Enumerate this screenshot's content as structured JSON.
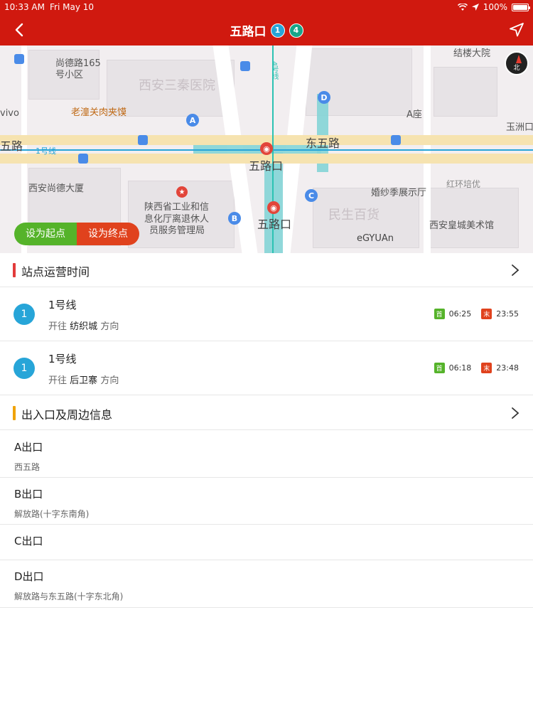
{
  "status": {
    "time": "10:33 AM",
    "date": "Fri May 10",
    "battery": "100%"
  },
  "nav": {
    "title": "五路口",
    "lines": [
      {
        "label": "1",
        "color": "#27a5d8"
      },
      {
        "label": "4",
        "color": "#17a589"
      }
    ]
  },
  "map": {
    "labels": {
      "shangde165": "尚德路165",
      "xiaoqu": "号小区",
      "hospital": "西安三秦医院",
      "jielou": "结楼大院",
      "vivo": "vivo",
      "laotong": "老潼关肉夹馍",
      "line4": "4号线",
      "azuo": "A座",
      "yuzhou": "玉洲口",
      "wulu_left": "五路",
      "line1": "1号线",
      "dongwulu": "东五路",
      "wukou_center": "五路口",
      "xian_shangde": "西安尚德大厦",
      "shaanxi": "陕西省工业和信",
      "shaanxi2": "息化厅离退休人",
      "shaanxi3": "员服务管理局",
      "hunsha": "婚纱季展示厅",
      "honghuan": "红环培优",
      "minsheng": "民生百货",
      "wukou_lower": "五路口",
      "xian_huangcheng": "西安皇城美术馆",
      "egyuan": "eGYUAn"
    },
    "exits": [
      "A",
      "B",
      "C",
      "D"
    ],
    "buttons": {
      "set_start": "设为起点",
      "set_end": "设为终点"
    },
    "compass": "北"
  },
  "hours_section": {
    "title": "站点运营时间",
    "bar_color": "#e23b3b"
  },
  "lines": [
    {
      "badge": "1",
      "name": "1号线",
      "dir_prefix": "开往",
      "destination": "纺织城",
      "dir_suffix": "方向",
      "first_tag": "首",
      "first": "06:25",
      "last_tag": "末",
      "last": "23:55"
    },
    {
      "badge": "1",
      "name": "1号线",
      "dir_prefix": "开往",
      "destination": "后卫寨",
      "dir_suffix": "方向",
      "first_tag": "首",
      "first": "06:18",
      "last_tag": "末",
      "last": "23:48"
    }
  ],
  "exits_section": {
    "title": "出入口及周边信息",
    "bar_color": "#f0a30a"
  },
  "exits": [
    {
      "name": "A出口",
      "desc": "西五路"
    },
    {
      "name": "B出口",
      "desc": "解放路(十字东南角)"
    },
    {
      "name": "C出口",
      "desc": ""
    },
    {
      "name": "D出口",
      "desc": "解放路与东五路(十字东北角)"
    }
  ]
}
